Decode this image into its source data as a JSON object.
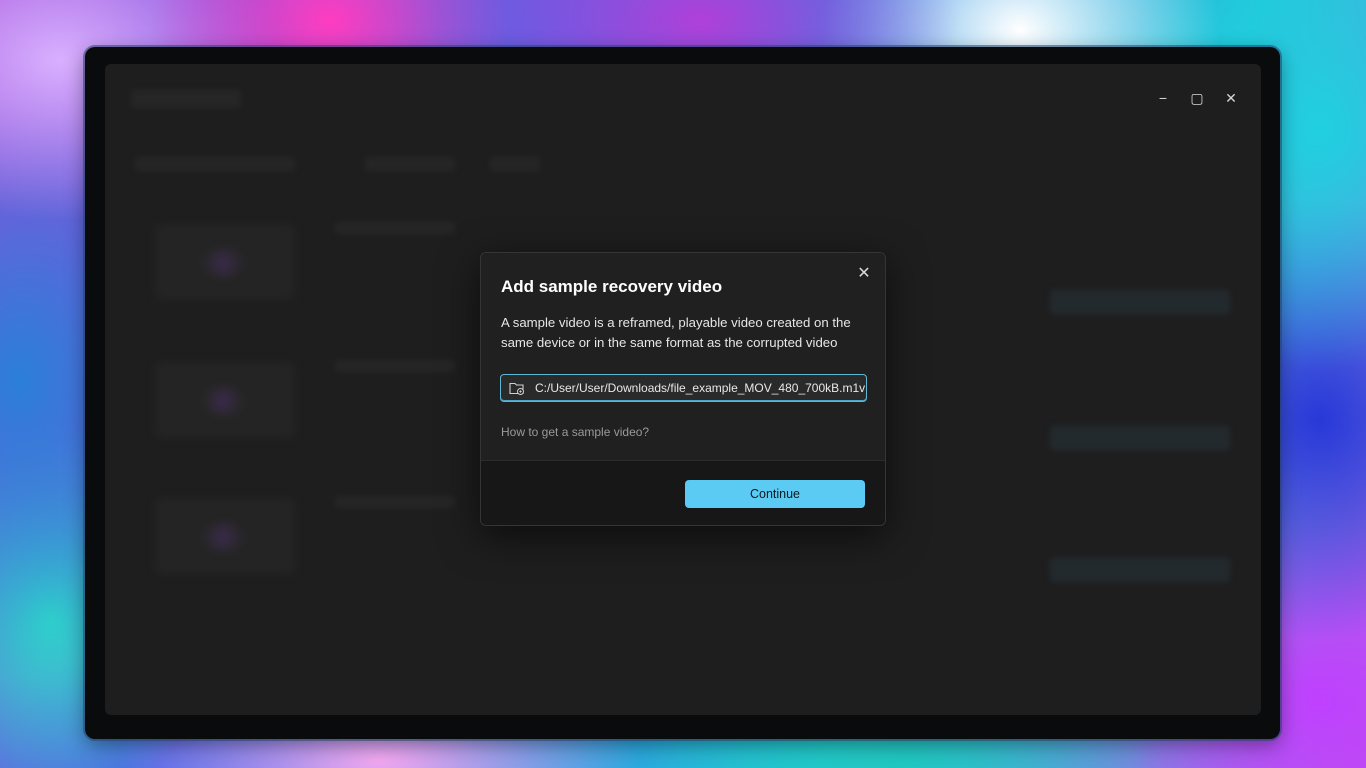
{
  "window": {
    "controls": {
      "minimize_glyph": "−",
      "maximize_glyph": "▢",
      "close_glyph": "✕"
    }
  },
  "dialog": {
    "title": "Add sample recovery video",
    "description": "A sample video is a reframed, playable video created on the same device or in the same format as the corrupted video",
    "path_value": "C:/User/User/Downloads/file_example_MOV_480_700kB.m1v",
    "help_link": "How to get a sample video?",
    "continue_label": "Continue",
    "close_glyph": "✕"
  },
  "colors": {
    "accent": "#5ccbf4",
    "dialog_bg": "#202020",
    "window_bg": "#1e1e1e"
  },
  "icons": {
    "field_icon": "folder-icon"
  }
}
